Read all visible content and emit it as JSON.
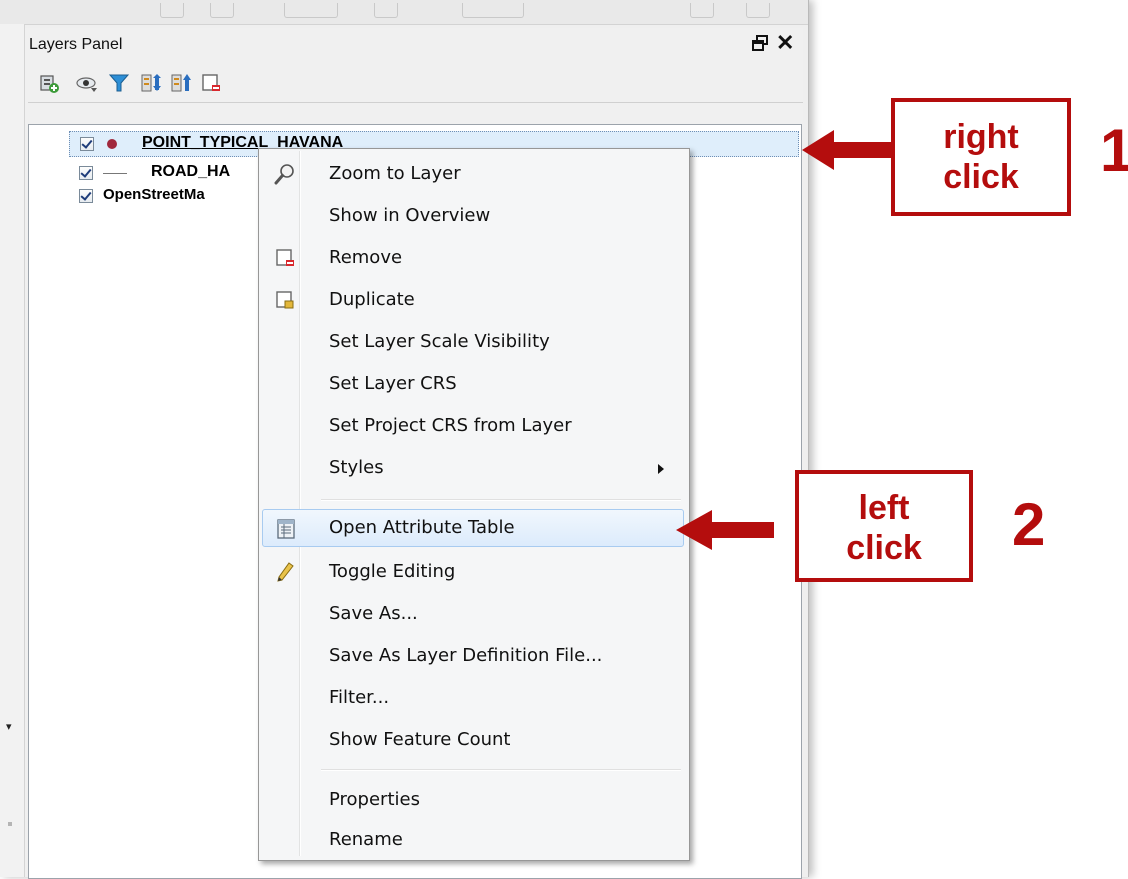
{
  "panel": {
    "title": "Layers Panel",
    "toolbar_icons": [
      "add-group-icon",
      "eye-icon",
      "filter-icon",
      "expand-all-icon",
      "collapse-all-icon",
      "remove-layer-icon"
    ]
  },
  "layers": [
    {
      "name": "POINT_TYPICAL_HAVANA",
      "visible_text": "POINT_TYPICAL_HAVANA",
      "checked": true,
      "symbol": "point",
      "symbol_color": "#a0283c",
      "selected": true
    },
    {
      "name": "ROAD_HAVANA",
      "visible_text": "ROAD_HA",
      "checked": true,
      "symbol": "line"
    },
    {
      "name": "OpenStreetMap",
      "visible_text": "OpenStreetMa",
      "checked": true,
      "symbol": "none"
    }
  ],
  "context_menu": {
    "items": [
      {
        "label": "Zoom to Layer",
        "icon": "zoom-icon"
      },
      {
        "label": "Show in Overview"
      },
      {
        "label": "Remove",
        "icon": "remove-icon"
      },
      {
        "label": "Duplicate",
        "icon": "duplicate-icon"
      },
      {
        "label": "Set Layer Scale Visibility"
      },
      {
        "label": "Set Layer CRS"
      },
      {
        "label": "Set Project CRS from Layer"
      },
      {
        "label": "Styles",
        "submenu": true
      },
      {
        "label": "Open Attribute Table",
        "icon": "table-icon",
        "highlighted": true
      },
      {
        "label": "Toggle Editing",
        "icon": "pencil-icon"
      },
      {
        "label": "Save As..."
      },
      {
        "label": "Save As Layer Definition File..."
      },
      {
        "label": "Filter..."
      },
      {
        "label": "Show Feature Count"
      },
      {
        "label": "Properties"
      },
      {
        "label": "Rename"
      }
    ]
  },
  "annotations": {
    "step1": {
      "line1": "right",
      "line2": "click",
      "number": "1"
    },
    "step2": {
      "line1": "left",
      "line2": "click",
      "number": "2"
    },
    "color": "#b40d0d"
  }
}
